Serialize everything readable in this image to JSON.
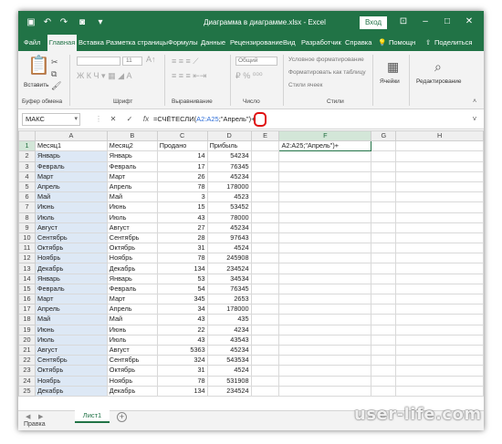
{
  "titlebar": {
    "doc_title": "Диаграмма в диаграмме.xlsx - Excel",
    "signin": "Вход",
    "save_icon": "save-icon",
    "undo_icon": "undo-icon",
    "redo_icon": "redo-icon",
    "camera_icon": "camera-icon"
  },
  "tabs": [
    "Файл",
    "Главная",
    "Вставка",
    "Разметка страницы",
    "Формулы",
    "Данные",
    "Рецензирование",
    "Вид",
    "Разработчик",
    "Справка"
  ],
  "tabs_right": {
    "help": "Помощн",
    "share": "Поделиться"
  },
  "ribbon": {
    "paste_label": "Вставить",
    "clipboard_label": "Буфер обмена",
    "font_label": "Шрифт",
    "align_label": "Выравнивание",
    "number_label": "Число",
    "number_format": "Общий",
    "styles_label": "Стили",
    "style_items": [
      "Условное форматирование",
      "Форматировать как таблицу",
      "Стили ячеек"
    ],
    "cells_label": "Ячейки",
    "editing_label": "Редактирование",
    "font_size": "11"
  },
  "formula_bar": {
    "name_box": "МАКС",
    "cancel": "✕",
    "enter": "✓",
    "fx": "fx",
    "formula_prefix": "=СЧЁТЕСЛИ(",
    "formula_ref": "A2:A25",
    "formula_rest": ";\"Апрель\")",
    "formula_tail": "+"
  },
  "columns": [
    "A",
    "B",
    "C",
    "D",
    "E",
    "F",
    "G",
    "H"
  ],
  "rows": [
    [
      "1",
      "Месяц1",
      "Месяц2",
      "Продано",
      "Прибыль"
    ],
    [
      "2",
      "Январь",
      "Январь",
      "14",
      "54234"
    ],
    [
      "3",
      "Февраль",
      "Февраль",
      "17",
      "76345"
    ],
    [
      "4",
      "Март",
      "Март",
      "26",
      "45234"
    ],
    [
      "5",
      "Апрель",
      "Апрель",
      "78",
      "178000"
    ],
    [
      "6",
      "Май",
      "Май",
      "3",
      "4523"
    ],
    [
      "7",
      "Июнь",
      "Июнь",
      "15",
      "53452"
    ],
    [
      "8",
      "Июль",
      "Июль",
      "43",
      "78000"
    ],
    [
      "9",
      "Август",
      "Август",
      "27",
      "45234"
    ],
    [
      "10",
      "Сентябрь",
      "Сентябрь",
      "28",
      "97643"
    ],
    [
      "11",
      "Октябрь",
      "Октябрь",
      "31",
      "4524"
    ],
    [
      "12",
      "Ноябрь",
      "Ноябрь",
      "78",
      "245908"
    ],
    [
      "13",
      "Декабрь",
      "Декабрь",
      "134",
      "234524"
    ],
    [
      "14",
      "Январь",
      "Январь",
      "53",
      "34534"
    ],
    [
      "15",
      "Февраль",
      "Февраль",
      "54",
      "76345"
    ],
    [
      "16",
      "Март",
      "Март",
      "345",
      "2653"
    ],
    [
      "17",
      "Апрель",
      "Апрель",
      "34",
      "178000"
    ],
    [
      "18",
      "Май",
      "Май",
      "43",
      "435"
    ],
    [
      "19",
      "Июнь",
      "Июнь",
      "22",
      "4234"
    ],
    [
      "20",
      "Июль",
      "Июль",
      "43",
      "43543"
    ],
    [
      "21",
      "Август",
      "Август",
      "5363",
      "45234"
    ],
    [
      "22",
      "Сентябрь",
      "Сентябрь",
      "324",
      "543534"
    ],
    [
      "23",
      "Октябрь",
      "Октябрь",
      "31",
      "4524"
    ],
    [
      "24",
      "Ноябрь",
      "Ноябрь",
      "78",
      "531908"
    ],
    [
      "25",
      "Декабрь",
      "Декабрь",
      "134",
      "234524"
    ]
  ],
  "active_cell": {
    "row": "1",
    "col": "F",
    "value": "A2:A25;\"Апрель\")+"
  },
  "sheet_tab": "Лист1",
  "status": "Правка",
  "watermark": "user-life.com"
}
